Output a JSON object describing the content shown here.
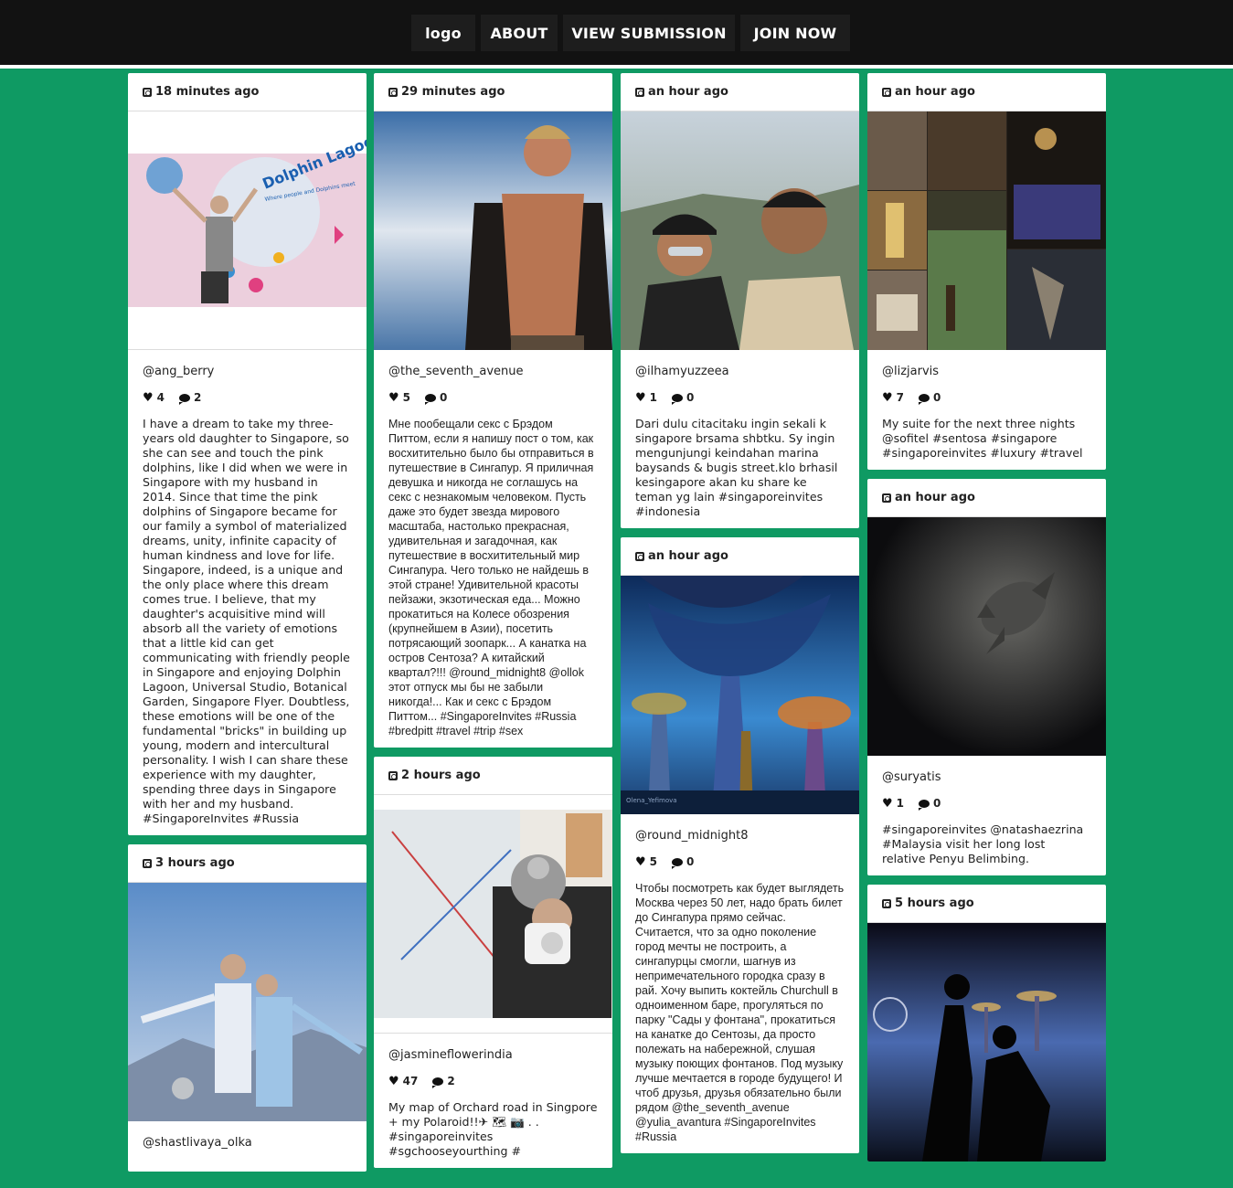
{
  "nav": {
    "logo": "logo",
    "about": "ABOUT",
    "view_submission": "VIEW SUBMISSION",
    "join_now": "JOIN NOW"
  },
  "posts": {
    "ang_berry": {
      "time": "18 minutes ago",
      "user": "@ang_berry",
      "likes": "4",
      "comments": "2",
      "caption": "I have a dream to take my three-years old daughter to Singapore, so she can see and touch the pink dolphins, like I did when we were in Singapore with my husband in 2014. Since that time the pink dolphins of Singapore became for our family a symbol of materialized dreams, unity, infinite capacity of human kindness and love for life. Singapore, indeed, is a unique and the only place where this dream comes true. I believe, that my daughter's acquisitive mind will absorb all the variety of emotions that a little kid can get communicating with friendly people in Singapore and enjoying Dolphin Lagoon, Universal Studio, Botanical Garden, Singapore Flyer. Doubtless, these emotions will be one of the fundamental \"bricks\" in building up young, modern and intercultural personality. I wish I can share these experience with my daughter, spending three days in Singapore with her and my husband. #SingaporeInvites #Russia",
      "image_label": "Dolphin Lagoon",
      "image_sublabel": "Where people and Dolphins meet"
    },
    "shastlivaya": {
      "time": "3 hours ago",
      "user": "@shastlivaya_olka"
    },
    "seventh_avenue": {
      "time": "29 minutes ago",
      "user": "@the_seventh_avenue",
      "likes": "5",
      "comments": "0",
      "caption": "Мне пообещали секс с Брэдом Питтом, если я напишу пост о том, как восхитительно было бы отправиться в путешествие в Сингапур. Я приличная девушка и никогда не соглашусь на секс с незнакомым человеком. Пусть даже это будет звезда мирового масштаба, настолько прекрасная, удивительная и загадочная, как путешествие в восхитительный мир Сингапура. Чего только не найдешь в этой стране! Удивительной красоты пейзажи, экзотическая еда... Можно прокатиться на Колесе обозрения (крупнейшем в Азии), посетить потрясающий зоопарк... А канатка на остров Сентоза? А китайский квартал?!!! @round_midnight8 @ollok этот отпуск мы бы не забыли никогда!... Как и секс с Брэдом Питтом... #SingaporeInvites #Russia #bredpitt #travel #trip #sex"
    },
    "jasmine": {
      "time": "2 hours ago",
      "user": "@jasmineflowerindia",
      "likes": "47",
      "comments": "2",
      "caption": "My map of Orchard road in Singpore + my Polaroid!!✈ 🗺 📷 . .",
      "caption_cut": "#singaporeinvites #sgchooseyourthing #"
    },
    "ilhamyuzzeea": {
      "time": "an hour ago",
      "user": "@ilhamyuzzeea",
      "likes": "1",
      "comments": "0",
      "caption": "Dari dulu citacitaku ingin sekali k singapore brsama shbtku. Sy ingin mengunjungi keindahan marina baysands & bugis street.klo brhasil kesingapore akan ku share ke teman yg lain #singaporeinvites #indonesia"
    },
    "round_midnight": {
      "time": "an hour ago",
      "user": "@round_midnight8",
      "likes": "5",
      "comments": "0",
      "caption": "Чтобы посмотреть как будет выглядеть Москва через 50 лет, надо брать билет до Сингапура прямо сейчас. Считается, что за одно поколение город мечты не построить, а сингапурцы смогли, шагнув из непримечательного городка сразу в рай. Хочу выпить коктейль Churchull в одноименном баре, прогуляться по парку \"Сады у фонтана\", прокатиться на канатке до Сентозы, да просто полежать на набережной, слушая музыку поющих фонтанов. Под музыку лучше мечтается в городе будущего! И чтоб друзья, друзья обязательно были рядом @the_seventh_avenue @yulia_avantura #SingaporeInvites #Russia",
      "image_credit": "Olena_Yefimova"
    },
    "lizjarvis": {
      "time": "an hour ago",
      "user": "@lizjarvis",
      "likes": "7",
      "comments": "0",
      "caption": "My suite for the next three nights @sofitel #sentosa #singapore #singaporeinvites #luxury #travel"
    },
    "suryatis": {
      "time": "an hour ago",
      "user": "@suryatis",
      "likes": "1",
      "comments": "0",
      "caption": "#singaporeinvites @natashaezrina #Malaysia visit her long lost relative Penyu Belimbing."
    },
    "five_hours": {
      "time": "5 hours ago"
    }
  }
}
